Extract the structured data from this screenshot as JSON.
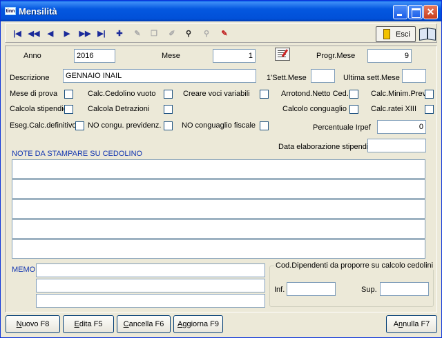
{
  "window": {
    "title": "Mensilità",
    "icon_text": "tinn"
  },
  "toolbar": {
    "icons": [
      "first-record",
      "prev-page",
      "prev-record",
      "next-record",
      "next-page",
      "last-record",
      "new-record",
      "edit-record",
      "copy-record",
      "delete-record",
      "search",
      "search-disabled",
      "clear-filter"
    ],
    "exit_label": "Esci",
    "help_icon": "book"
  },
  "form": {
    "anno_label": "Anno",
    "anno_value": "2016",
    "mese_label": "Mese",
    "mese_value": "1",
    "progr_label": "Progr.Mese",
    "progr_value": "9",
    "descrizione_label": "Descrizione",
    "descrizione_value": "GENNAIO INAIL",
    "primo_sett_label": "1'Sett.Mese",
    "primo_sett_value": "",
    "ultima_sett_label": "Ultima sett.Mese",
    "ultima_sett_value": "",
    "checks": {
      "mese_prova": "Mese di prova",
      "calc_cedolino_vuoto": "Calc.Cedolino vuoto",
      "creare_voci": "Creare voci variabili",
      "arrotond_netto": "Arrotond.Netto Ced.",
      "calc_minim_prev": "Calc.Minim.Prev.",
      "calcola_stipendio": "Calcola stipendio",
      "calcola_detrazioni": "Calcola Detrazioni",
      "calcolo_conguaglio": "Calcolo conguaglio",
      "calc_ratei": "Calc.ratei XIII",
      "eseg_calc_def": "Eseg.Calc.definitivo",
      "no_congu_prev": "NO congu. previdenz.",
      "no_congu_fiscale": "NO conguaglio fiscale"
    },
    "percentuale_label": "Percentuale Irpef",
    "percentuale_value": "0",
    "data_elab_label": "Data elaborazione stipendi",
    "data_elab_value": "",
    "note_label": "NOTE DA STAMPARE SU CEDOLINO",
    "memo_label": "MEMO",
    "cod_dip_label": "Cod.Dipendenti da proporre su calcolo cedolini",
    "inf_label": "Inf.",
    "inf_value": "",
    "sup_label": "Sup.",
    "sup_value": ""
  },
  "buttons": {
    "nuovo_key": "N",
    "nuovo_rest": "uovo  F8",
    "edita_key": "E",
    "edita_rest": "dita  F5",
    "cancella_key": "C",
    "cancella_rest": "ancella  F6",
    "aggiorna_key": "A",
    "aggiorna_rest": "ggiorna  F9",
    "annulla_pre": "A",
    "annulla_key": "n",
    "annulla_rest": "nulla  F7"
  },
  "colors": {
    "title_bar": "#0458e0",
    "label_blue": "#1034b0",
    "window_bg": "#ece9d8"
  }
}
